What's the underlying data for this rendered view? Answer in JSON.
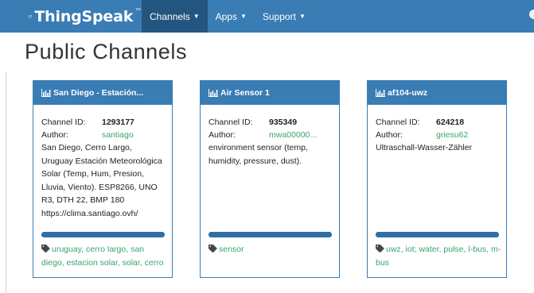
{
  "navbar": {
    "brand": "ThingSpeak",
    "trademark": "™",
    "items": [
      {
        "label": "Channels",
        "active": true,
        "dropdown": true
      },
      {
        "label": "Apps",
        "active": false,
        "dropdown": true
      },
      {
        "label": "Support",
        "active": false,
        "dropdown": true
      }
    ],
    "color": "#3a7cb4",
    "active_color": "#22557f"
  },
  "page": {
    "title": "Public Channels"
  },
  "cards": [
    {
      "title": "San Diego - Estación...",
      "channel_id_label": "Channel ID:",
      "channel_id": "1293177",
      "author_label": "Author:",
      "author": "santiago",
      "description": "San Diego, Cerro Largo, Uruguay Estación Meteorológica Solar (Temp, Hum, Presion, Lluvia, Viento). ESP8266, UNO R3, DTH 22, BMP 180 https://clima.santiago.ovh/",
      "progress": 1.0,
      "tags": [
        "uruguay",
        "cerro largo",
        "san diego",
        "estacion solar",
        "solar",
        "cerro"
      ]
    },
    {
      "title": "Air Sensor 1",
      "channel_id_label": "Channel ID:",
      "channel_id": "935349",
      "author_label": "Author:",
      "author": "mwa00000...",
      "description": "environment sensor (temp, humidity, pressure, dust).",
      "progress": 1.0,
      "tags": [
        "sensor"
      ]
    },
    {
      "title": "af104-uwz",
      "channel_id_label": "Channel ID:",
      "channel_id": "624218",
      "author_label": "Author:",
      "author": "griesu62",
      "description": "Ultraschall-Wasser-Zähler",
      "progress": 1.0,
      "tags": [
        "uwz",
        "iot; water",
        "pulse",
        "l-bus",
        "m-bus"
      ]
    }
  ],
  "icons": {
    "brand": "chat-bubble-icon",
    "card_header": "bar-chart-icon",
    "tags": "tag-icon"
  },
  "colors": {
    "link": "#3aa36b",
    "progress": "#2f6fa4"
  }
}
